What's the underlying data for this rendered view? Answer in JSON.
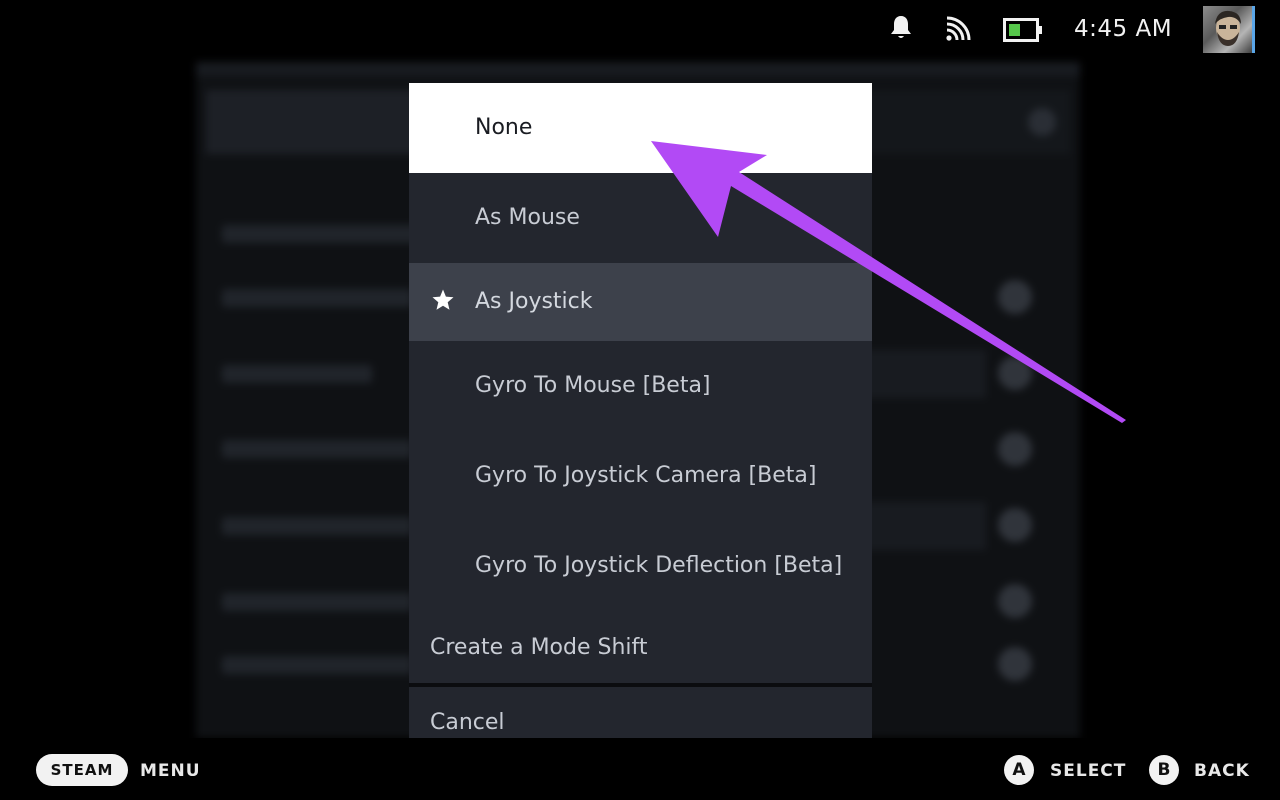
{
  "status_bar": {
    "icons": [
      "bell-icon",
      "wifi-icon",
      "battery-icon"
    ],
    "time": "4:45 AM",
    "battery_color": "#55c64a"
  },
  "menu": {
    "items": [
      {
        "label": "None",
        "state": "selected"
      },
      {
        "label": "As Mouse",
        "state": "normal"
      },
      {
        "label": "As Joystick",
        "state": "active",
        "icon": "star-icon"
      },
      {
        "label": "Gyro To Mouse [Beta]",
        "state": "normal"
      },
      {
        "label": "Gyro To Joystick Camera [Beta]",
        "state": "normal"
      },
      {
        "label": "Gyro To Joystick Deflection [Beta]",
        "state": "normal"
      }
    ],
    "mode_shift_label": "Create a Mode Shift",
    "cancel_label": "Cancel"
  },
  "annotation": {
    "icon": "arrow-icon",
    "color": "#b24af5"
  },
  "bottom_bar": {
    "steam_label": "STEAM",
    "menu_label": "MENU",
    "a_button": "A",
    "select_label": "SELECT",
    "b_button": "B",
    "back_label": "BACK"
  },
  "colors": {
    "menu_bg": "#23262e",
    "menu_selected_bg": "#ffffff",
    "menu_active_bg": "#3d414b"
  }
}
